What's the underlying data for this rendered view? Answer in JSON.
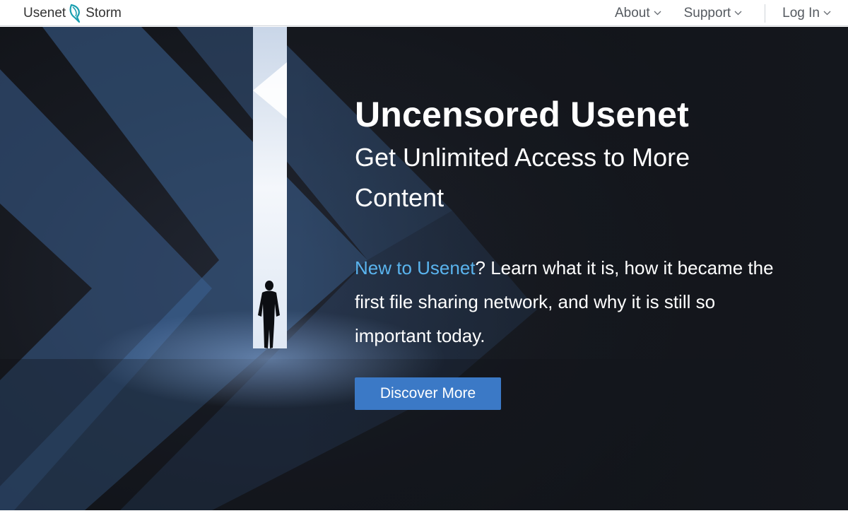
{
  "header": {
    "logo_left": "Usenet",
    "logo_right": "Storm",
    "logo_icon": "storm-leaf-icon",
    "nav": {
      "about_label": "About",
      "support_label": "Support",
      "login_label": "Log In"
    }
  },
  "hero": {
    "title": "Uncensored Usenet",
    "subtitle": "Get Unlimited Access to More Content",
    "intro_link": "New to Usenet",
    "intro_rest": "?  Learn what it is, how it became the first file sharing network, and why it is still so important today.",
    "cta_label": "Discover More"
  },
  "colors": {
    "accent": "#3b79c6",
    "link": "#5ab4ee",
    "logo_teal": "#1a9fb0",
    "hero_bg": "#171a21"
  }
}
